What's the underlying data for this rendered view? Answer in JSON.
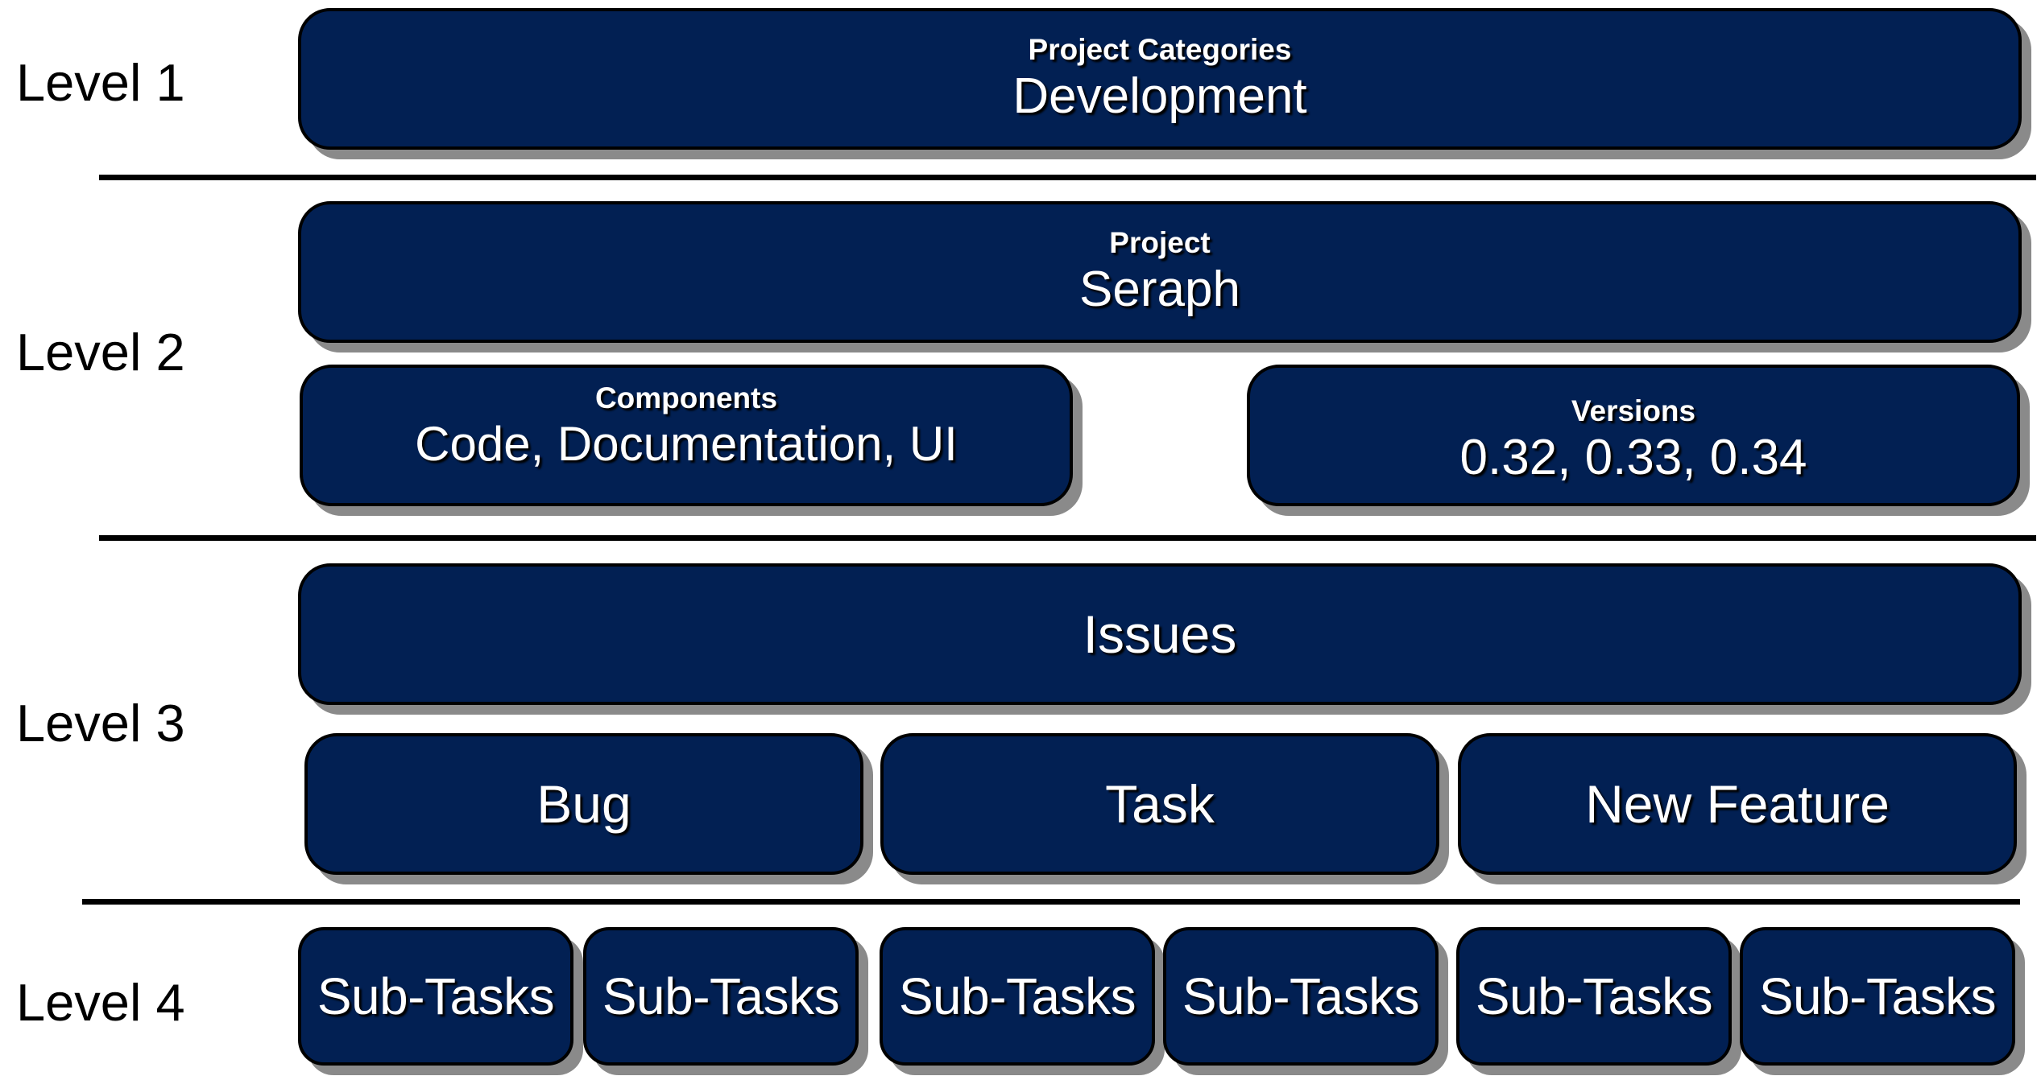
{
  "levels": [
    "Level 1",
    "Level 2",
    "Level 3",
    "Level 4"
  ],
  "level1": {
    "category_heading": "Project Categories",
    "category_value": "Development"
  },
  "level2": {
    "project_heading": "Project",
    "project_value": "Seraph",
    "components_heading": "Components",
    "components_value": "Code, Documentation, UI",
    "versions_heading": "Versions",
    "versions_value": "0.32, 0.33, 0.34"
  },
  "level3": {
    "issues_label": "Issues",
    "issue_types": [
      "Bug",
      "Task",
      "New Feature"
    ]
  },
  "level4": {
    "subtasks": [
      "Sub-Tasks",
      "Sub-Tasks",
      "Sub-Tasks",
      "Sub-Tasks",
      "Sub-Tasks",
      "Sub-Tasks"
    ]
  },
  "colors": {
    "box_fill": "#022053",
    "box_border": "#000000",
    "shadow": "#8a8a8a",
    "text": "#ffffff"
  }
}
